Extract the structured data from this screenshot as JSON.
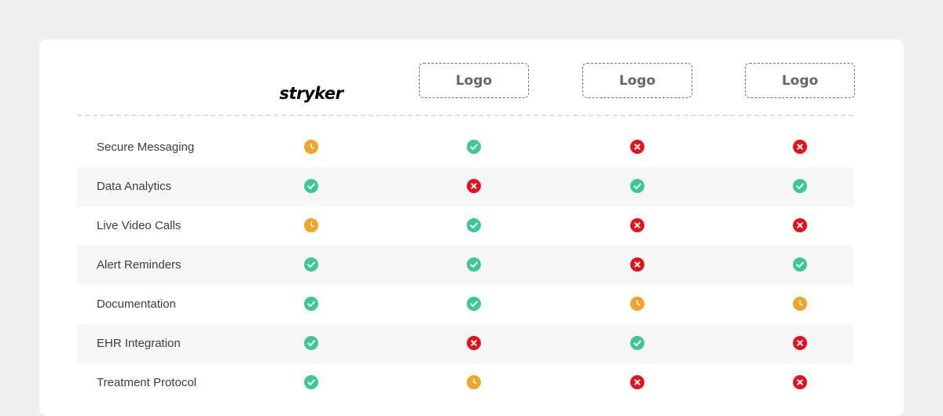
{
  "colors": {
    "background": "#eef1f4",
    "card": "#ffffff",
    "check": "#3cc894",
    "cross": "#e0141e",
    "pending": "#f0a42a",
    "row_alt": "#f7f7f7"
  },
  "brands": [
    {
      "name": "stryker",
      "type": "logo"
    },
    {
      "name": "Logo",
      "type": "placeholder"
    },
    {
      "name": "Logo",
      "type": "placeholder"
    },
    {
      "name": "Logo",
      "type": "placeholder"
    }
  ],
  "features": [
    {
      "label": "Secure Messaging",
      "status": [
        "pending",
        "check",
        "cross",
        "cross"
      ]
    },
    {
      "label": "Data Analytics",
      "status": [
        "check",
        "cross",
        "check",
        "check"
      ]
    },
    {
      "label": "Live Video Calls",
      "status": [
        "pending",
        "check",
        "cross",
        "cross"
      ]
    },
    {
      "label": "Alert Reminders",
      "status": [
        "check",
        "check",
        "cross",
        "check"
      ]
    },
    {
      "label": "Documentation",
      "status": [
        "check",
        "check",
        "pending",
        "pending"
      ]
    },
    {
      "label": "EHR Integration",
      "status": [
        "check",
        "cross",
        "check",
        "cross"
      ]
    },
    {
      "label": "Treatment Protocol",
      "status": [
        "check",
        "pending",
        "cross",
        "cross"
      ]
    }
  ],
  "icons": {
    "check": "check-circle-icon",
    "cross": "x-circle-icon",
    "pending": "clock-circle-icon"
  }
}
